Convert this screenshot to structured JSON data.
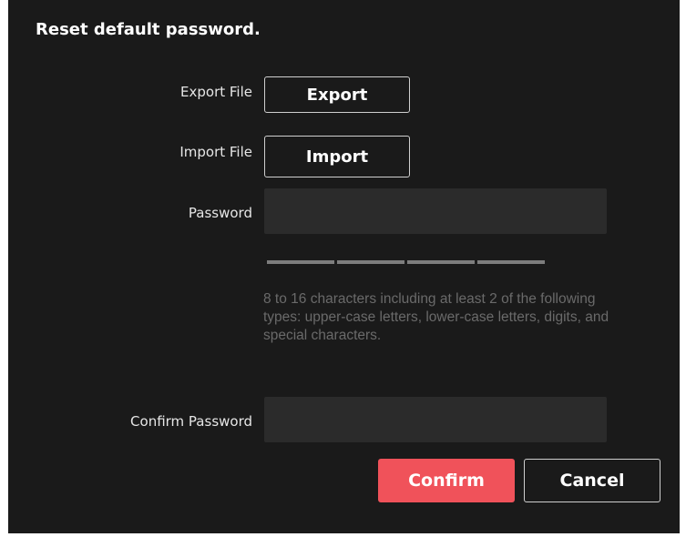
{
  "dialog": {
    "title": "Reset default password."
  },
  "export": {
    "label": "Export File",
    "button": "Export"
  },
  "import": {
    "label": "Import File",
    "button": "Import"
  },
  "password": {
    "label": "Password",
    "value": "",
    "strength_segments": 4,
    "hint": "8 to 16 characters including at least 2 of the following types: upper-case letters, lower-case letters, digits, and special characters."
  },
  "confirm_password": {
    "label": "Confirm Password",
    "value": ""
  },
  "actions": {
    "confirm": "Confirm",
    "cancel": "Cancel"
  },
  "colors": {
    "background": "#1a1a1a",
    "input_background": "#2b2b2b",
    "primary": "#f0525a",
    "hint_text": "#6a6a6a",
    "strength_bar": "#7d7d7d"
  }
}
